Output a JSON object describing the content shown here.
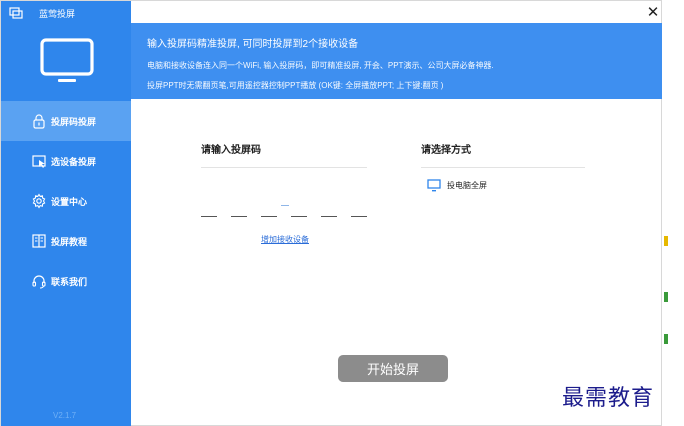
{
  "app": {
    "title": "蓝莺投屏",
    "version": "V2.1.7"
  },
  "header": {
    "line1": "输入投屏码精准投屏, 可同时投屏到2个接收设备",
    "line2": "电脑和接收设备连入同一个WiFi, 输入投屏码，即可精准投屏, 开会、PPT演示、公司大屏必备神器.",
    "line3": "投屏PPT时无需翻页笔,可用遥控器控制PPT播放 (OK键: 全屏播放PPT; 上下键:翻页 )"
  },
  "sidebar": {
    "items": [
      {
        "label": "投屏码投屏",
        "icon": "lock-icon",
        "active": true
      },
      {
        "label": "选设备投屏",
        "icon": "select-device-icon",
        "active": false
      },
      {
        "label": "设置中心",
        "icon": "gear-icon",
        "active": false
      },
      {
        "label": "投屏教程",
        "icon": "book-icon",
        "active": false
      },
      {
        "label": "联系我们",
        "icon": "headset-icon",
        "active": false
      }
    ]
  },
  "code_section": {
    "title": "请输入投屏码",
    "add_link": "增加接收设备"
  },
  "mode_section": {
    "title": "请选择方式",
    "option_label": "投电脑全屏"
  },
  "actions": {
    "start_label": "开始投屏"
  },
  "watermark": "最需教育",
  "colors": {
    "sidebar": "#2f86ec",
    "sidebar_active": "#5aa2f2",
    "header": "#3e8ff0",
    "button_disabled": "#8c8c8c",
    "link": "#2a6cd8"
  },
  "icons": {
    "close": "close-icon",
    "monitor": "monitor-icon",
    "logo": "app-logo-icon",
    "option": "monitor-icon"
  }
}
